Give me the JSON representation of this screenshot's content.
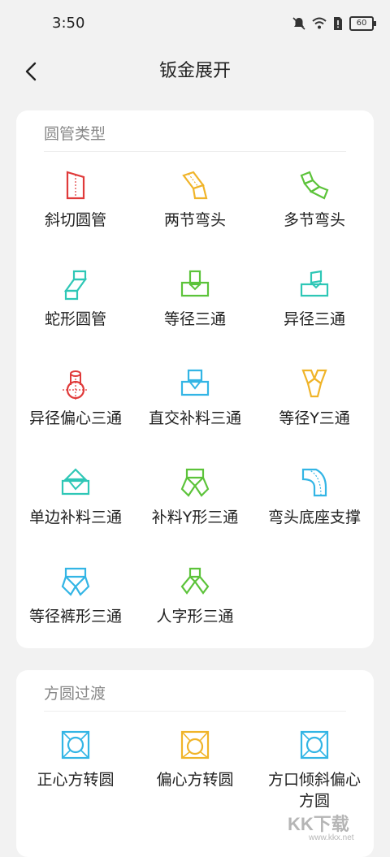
{
  "status": {
    "time": "3:50",
    "battery": "60"
  },
  "nav": {
    "title": "钣金展开"
  },
  "sections": [
    {
      "title": "圆管类型",
      "items": [
        {
          "label": "斜切圆管",
          "icon": "oblique-cut-pipe-icon",
          "color": "#e03a3a"
        },
        {
          "label": "两节弯头",
          "icon": "two-section-elbow-icon",
          "color": "#f0b429"
        },
        {
          "label": "多节弯头",
          "icon": "multi-section-elbow-icon",
          "color": "#5cc33a"
        },
        {
          "label": "蛇形圆管",
          "icon": "snake-pipe-icon",
          "color": "#2ec7b6"
        },
        {
          "label": "等径三通",
          "icon": "equal-tee-icon",
          "color": "#5cc33a"
        },
        {
          "label": "异径三通",
          "icon": "reducing-tee-icon",
          "color": "#2ec7b6"
        },
        {
          "label": "异径偏心三通",
          "icon": "eccentric-reducing-tee-icon",
          "color": "#e03a3a"
        },
        {
          "label": "直交补料三通",
          "icon": "orthogonal-patch-tee-icon",
          "color": "#33b5e5"
        },
        {
          "label": "等径Y三通",
          "icon": "equal-y-tee-icon",
          "color": "#f0b429"
        },
        {
          "label": "单边补料三通",
          "icon": "single-side-patch-tee-icon",
          "color": "#2ec7b6"
        },
        {
          "label": "补料Y形三通",
          "icon": "patch-y-tee-icon",
          "color": "#5cc33a"
        },
        {
          "label": "弯头底座支撑",
          "icon": "elbow-base-support-icon",
          "color": "#33b5e5"
        },
        {
          "label": "等径裤形三通",
          "icon": "equal-trouser-tee-icon",
          "color": "#33b5e5"
        },
        {
          "label": "人字形三通",
          "icon": "herringbone-tee-icon",
          "color": "#5cc33a"
        }
      ]
    },
    {
      "title": "方圆过渡",
      "items": [
        {
          "label": "正心方转圆",
          "icon": "centered-square-to-round-icon",
          "color": "#33b5e5"
        },
        {
          "label": "偏心方转圆",
          "icon": "eccentric-square-to-round-icon",
          "color": "#f0b429"
        },
        {
          "label": "方口倾斜偏心方圆",
          "icon": "inclined-eccentric-square-round-icon",
          "color": "#33b5e5"
        }
      ]
    }
  ],
  "watermark": {
    "text": "KK下载",
    "url": "www.kkx.net"
  }
}
